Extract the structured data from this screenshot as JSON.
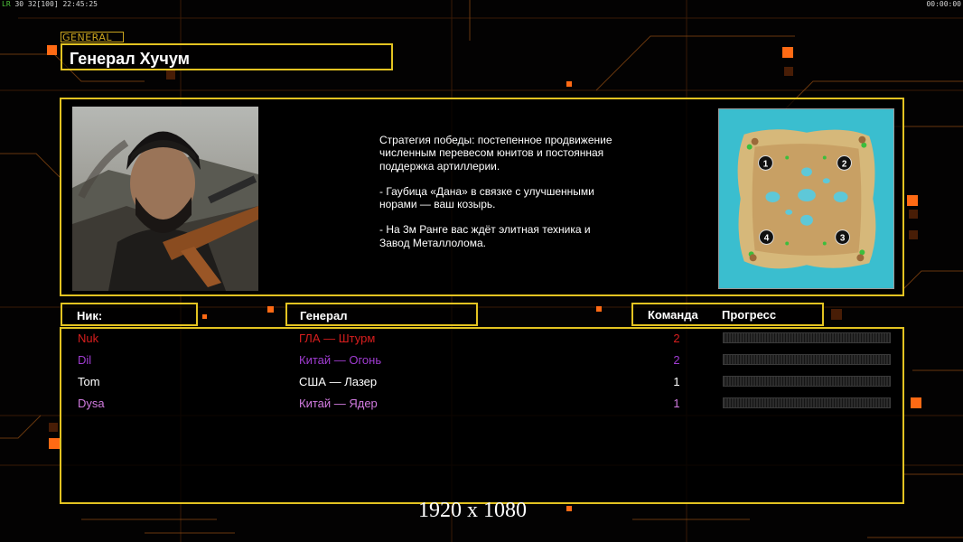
{
  "hud": {
    "fps_tag": "LR",
    "fps_values": "30 32[100]",
    "clock": "22:45:25",
    "timer": "00:00:00"
  },
  "general_tag": "GENERAL",
  "title": "Генерал Хучум",
  "description": [
    "Стратегия победы: постепенное продвижение численным перевесом юнитов и постоянная поддержка артиллерии.",
    "- Гаубица «Дана» в связке с улучшенными норами — ваш козырь.",
    "- На 3м Ранге вас ждёт элитная техника и Завод Металлолома."
  ],
  "minimap": {
    "spawns": [
      "1",
      "2",
      "3",
      "4"
    ]
  },
  "headers": {
    "nick": "Ник:",
    "general": "Генерал",
    "team": "Команда",
    "progress": "Прогресс"
  },
  "players": [
    {
      "nick": "Nuk",
      "general": "ГЛА — Штурм",
      "team": "2",
      "color": "#d81e1e"
    },
    {
      "nick": "Dil",
      "general": "Китай — Огонь",
      "team": "2",
      "color": "#a03cd2"
    },
    {
      "nick": "Tom",
      "general": "США — Лазер",
      "team": "1",
      "color": "#ffffff"
    },
    {
      "nick": "Dysa",
      "general": "Китай — Ядер",
      "team": "1",
      "color": "#d27be0"
    }
  ],
  "resolution": "1920 x 1080",
  "colors": {
    "accent": "#e3c321",
    "tag": "#c9a41e",
    "orange": "#ff7a14"
  }
}
